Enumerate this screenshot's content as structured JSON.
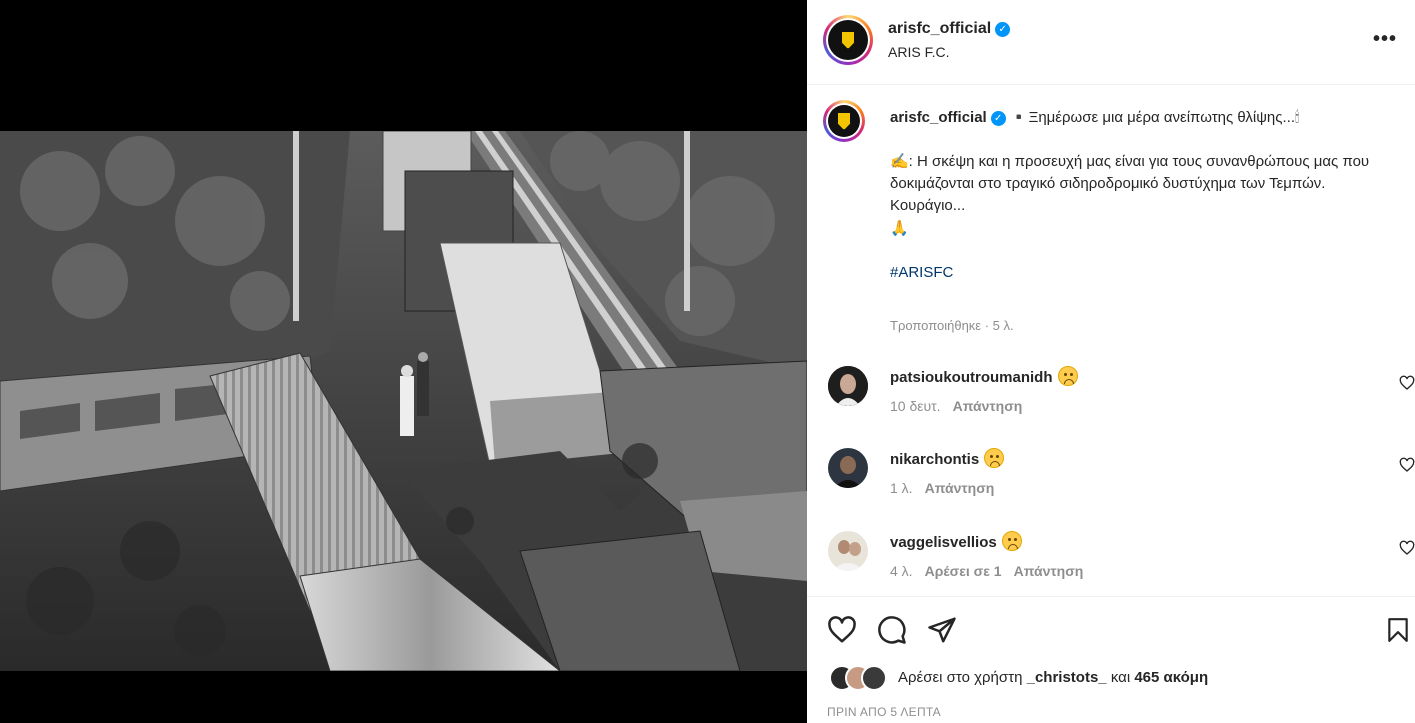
{
  "post": {
    "author": {
      "username": "arisfc_official",
      "display_name": "ARIS F.C.",
      "verified": true
    },
    "caption": {
      "first_line": "▪️Ξημέρωσε μια μέρα ανείπωτης θλίψης...🕯",
      "body": "✍️: Η σκέψη και η προσευχή μας είναι για τους συνανθρώπους μας που δοκιμάζονται στο τραγικό σιδηροδρομικό δυστύχημα των Τεμπών.",
      "line3": "Κουράγιο...",
      "line4": "🙏",
      "hashtag": "#ARISFC",
      "edited_label": "Τροποποιήθηκε · 5 λ."
    },
    "comments": [
      {
        "username": "patsioukoutroumanidh",
        "emoji": "sad-face",
        "time": "10 δευτ.",
        "likes": "",
        "reply_label": "Απάντηση"
      },
      {
        "username": "nikarchontis",
        "emoji": "sad-face",
        "time": "1 λ.",
        "likes": "",
        "reply_label": "Απάντηση"
      },
      {
        "username": "vaggelisvellios",
        "emoji": "sad-face",
        "time": "4 λ.",
        "likes": "Αρέσει σε 1",
        "reply_label": "Απάντηση"
      }
    ],
    "likes": {
      "prefix": "Αρέσει στο χρήστη",
      "user": "_christots_",
      "conjunction": "και",
      "more": "465 ακόμη"
    },
    "timestamp": "ΠΡΙΝ ΑΠΟ 5 ΛΕΠΤΑ"
  },
  "icons": {
    "more": "more-horizontal-icon",
    "like": "heart-icon",
    "comment": "comment-icon",
    "share": "send-icon",
    "save": "bookmark-icon",
    "verified": "verified-badge-icon"
  },
  "colors": {
    "verified": "#0095f6",
    "hashtag": "#00376b",
    "secondary_text": "#8e8e8e",
    "brand_yellow": "#f2c500"
  }
}
